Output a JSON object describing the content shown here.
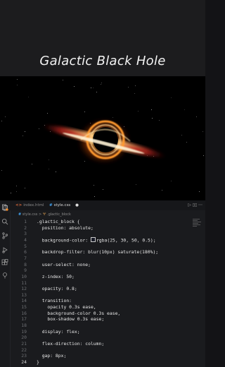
{
  "banner": {
    "title": "Galactic Black Hole"
  },
  "tabs": [
    {
      "icon": "<>",
      "label": "index.html",
      "active": false
    },
    {
      "icon": "#",
      "label": "style.css",
      "active": true
    }
  ],
  "breadcrumb": {
    "file": "style.css",
    "separator": ">",
    "selector": ".glactic_block"
  },
  "code": {
    "current_line": 24,
    "lines": [
      {
        "n": "1",
        "text": ".glactic_block {"
      },
      {
        "n": "2",
        "text": "  position: absolute;"
      },
      {
        "n": "3",
        "text": ""
      },
      {
        "n": "4",
        "text": "  background-color: rgba(25, 30, 50, 0.5);",
        "swatch": true
      },
      {
        "n": "5",
        "text": ""
      },
      {
        "n": "6",
        "text": "  backdrop-filter: blur(10px) saturate(180%);"
      },
      {
        "n": "7",
        "text": ""
      },
      {
        "n": "8",
        "text": "  user-select: none;"
      },
      {
        "n": "9",
        "text": ""
      },
      {
        "n": "10",
        "text": "  z-index: 50;"
      },
      {
        "n": "11",
        "text": ""
      },
      {
        "n": "12",
        "text": "  opacity: 0.8;"
      },
      {
        "n": "13",
        "text": ""
      },
      {
        "n": "14",
        "text": "  transition:"
      },
      {
        "n": "15",
        "text": "    opacity 0.3s ease,"
      },
      {
        "n": "16",
        "text": "    background-color 0.3s ease,"
      },
      {
        "n": "17",
        "text": "    box-shadow 0.3s ease;"
      },
      {
        "n": "18",
        "text": ""
      },
      {
        "n": "19",
        "text": "  display: flex;"
      },
      {
        "n": "20",
        "text": ""
      },
      {
        "n": "21",
        "text": "  flex-direction: column;"
      },
      {
        "n": "22",
        "text": ""
      },
      {
        "n": "23",
        "text": "  gap: 8px;"
      },
      {
        "n": "24",
        "text": "}"
      }
    ]
  },
  "colors": {
    "accent_orange": "#ff8a1f",
    "editor_bg": "#1a1b1e"
  }
}
